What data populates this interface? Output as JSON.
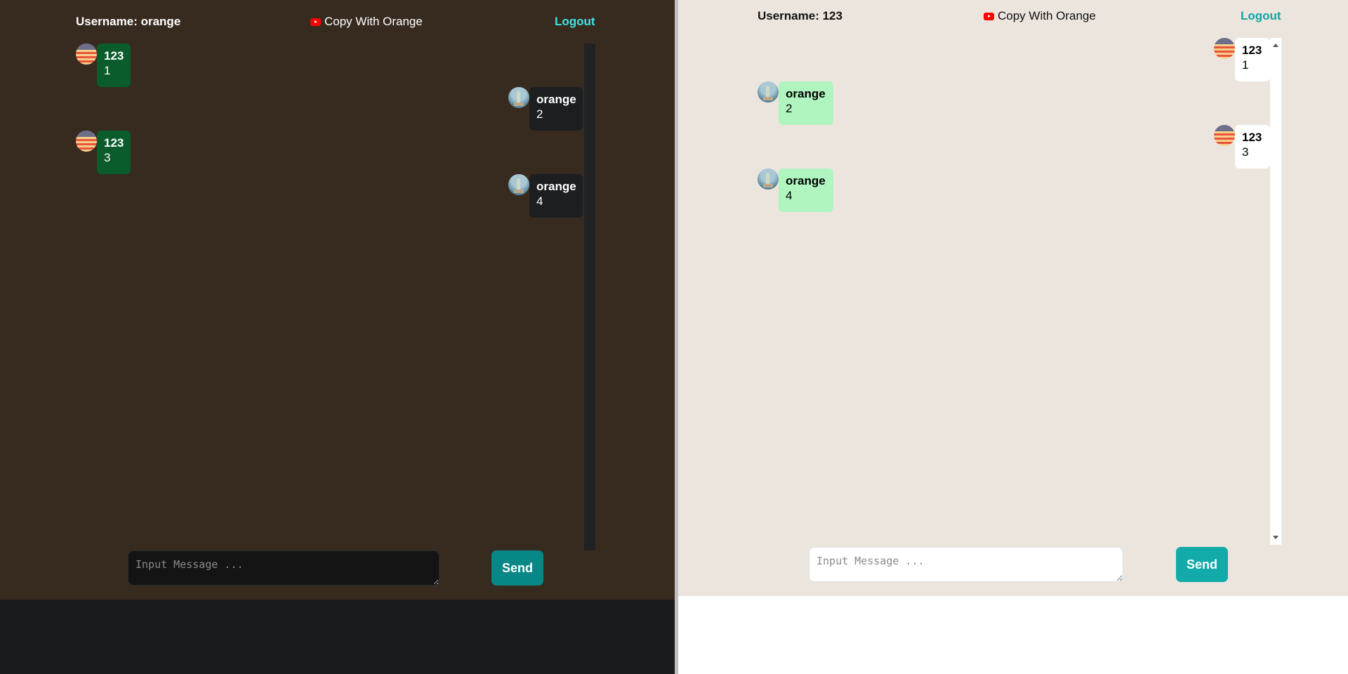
{
  "panes": {
    "left": {
      "username_label": "Username: orange",
      "brand_label": "Copy With Orange",
      "brand_icon": "youtube-icon",
      "logout_label": "Logout",
      "input_placeholder": "Input Message ...",
      "send_label": "Send",
      "messages": [
        {
          "sender": "123",
          "text": "1",
          "own": false,
          "avatar": "flag-avatar"
        },
        {
          "sender": "orange",
          "text": "2",
          "own": true,
          "avatar": "statue-avatar"
        },
        {
          "sender": "123",
          "text": "3",
          "own": false,
          "avatar": "flag-avatar"
        },
        {
          "sender": "orange",
          "text": "4",
          "own": true,
          "avatar": "statue-avatar"
        }
      ]
    },
    "right": {
      "username_label": "Username: 123",
      "brand_label": "Copy With Orange",
      "brand_icon": "youtube-icon",
      "logout_label": "Logout",
      "input_placeholder": "Input Message ...",
      "send_label": "Send",
      "messages": [
        {
          "sender": "123",
          "text": "1",
          "own": true,
          "avatar": "flag-avatar"
        },
        {
          "sender": "orange",
          "text": "2",
          "own": false,
          "avatar": "statue-avatar"
        },
        {
          "sender": "123",
          "text": "3",
          "own": true,
          "avatar": "flag-avatar"
        },
        {
          "sender": "orange",
          "text": "4",
          "own": false,
          "avatar": "statue-avatar"
        }
      ]
    }
  },
  "colors": {
    "dark_background": "#372b20",
    "dark_other_bubble": "#0a5c2c",
    "dark_own_bubble": "#1d1e20",
    "dark_accent": "#3ee6e6",
    "light_background": "#ebe5de",
    "light_other_bubble": "#b0f5c0",
    "light_own_bubble": "#ffffff",
    "light_accent": "#0fa3a3",
    "send_button_dark": "#088787",
    "send_button_light": "#13aaaa",
    "brand_icon_red": "#ff0000"
  }
}
